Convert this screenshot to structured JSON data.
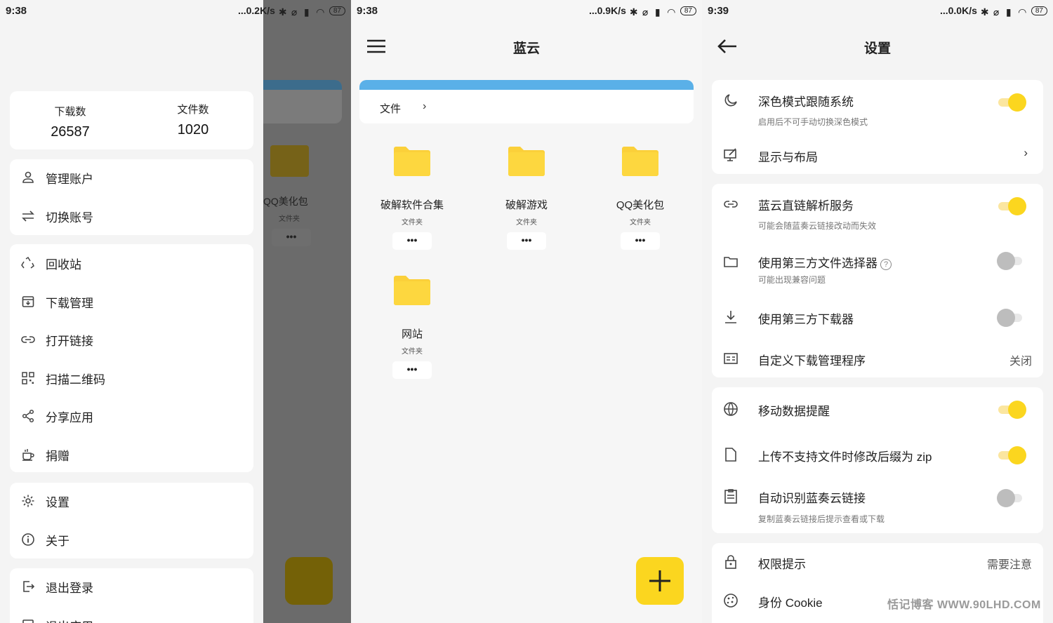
{
  "panel1": {
    "status": {
      "time": "9:38",
      "speed": "...0.2K/s",
      "battery": "87"
    },
    "stats": {
      "downloads_label": "下载数",
      "downloads_value": "26587",
      "files_label": "文件数",
      "files_value": "1020"
    },
    "group1": [
      {
        "label": "管理账户",
        "icon": "person-icon"
      },
      {
        "label": "切换账号",
        "icon": "swap-icon"
      }
    ],
    "group2": [
      {
        "label": "回收站",
        "icon": "recycle-icon"
      },
      {
        "label": "下载管理",
        "icon": "download-box-icon"
      },
      {
        "label": "打开链接",
        "icon": "link-icon"
      },
      {
        "label": "扫描二维码",
        "icon": "qrcode-icon"
      },
      {
        "label": "分享应用",
        "icon": "share-icon"
      },
      {
        "label": "捐赠",
        "icon": "coffee-icon"
      }
    ],
    "group3": [
      {
        "label": "设置",
        "icon": "gear-icon"
      },
      {
        "label": "关于",
        "icon": "info-icon"
      }
    ],
    "group4": [
      {
        "label": "退出登录",
        "icon": "logout-icon"
      },
      {
        "label": "退出应用",
        "icon": "exit-icon"
      }
    ],
    "behind": {
      "folder_name": "QQ美化包",
      "folder_sub": "文件夹",
      "more": "•••"
    }
  },
  "panel2": {
    "status": {
      "time": "9:38",
      "speed": "...0.9K/s",
      "battery": "87"
    },
    "title": "蓝云",
    "breadcrumb": "文件",
    "folders": [
      {
        "name": "破解软件合集",
        "sub": "文件夹",
        "more": "•••"
      },
      {
        "name": "破解游戏",
        "sub": "文件夹",
        "more": "•••"
      },
      {
        "name": "QQ美化包",
        "sub": "文件夹",
        "more": "•••"
      },
      {
        "name": "网站",
        "sub": "文件夹",
        "more": "•••"
      }
    ],
    "fab": "+"
  },
  "panel3": {
    "status": {
      "time": "9:39",
      "speed": "...0.0K/s",
      "battery": "87"
    },
    "title": "设置",
    "settings": {
      "dark_mode": {
        "title": "深色模式跟随系统",
        "sub": "启用后不可手动切换深色模式",
        "on": true
      },
      "display": {
        "title": "显示与布局"
      },
      "direct_link": {
        "title": "蓝云直链解析服务",
        "sub": "可能会随蓝奏云链接改动而失效",
        "on": true
      },
      "file_picker": {
        "title": "使用第三方文件选择器",
        "sub": "可能出现兼容问题",
        "on": false,
        "help": "?"
      },
      "downloader": {
        "title": "使用第三方下载器",
        "on": false
      },
      "custom_dm": {
        "title": "自定义下载管理程序",
        "value": "关闭"
      },
      "mobile_data": {
        "title": "移动数据提醒",
        "on": true
      },
      "zip_rename": {
        "title": "上传不支持文件时修改后缀为 zip",
        "on": true
      },
      "auto_detect": {
        "title": "自动识别蓝奏云链接",
        "sub": "复制蓝奏云链接后提示查看或下载",
        "on": false
      },
      "permission": {
        "title": "权限提示",
        "value": "需要注意"
      },
      "cookie": {
        "title": "身份 Cookie"
      }
    },
    "watermark": "恬记博客 WWW.90LHD.COM"
  },
  "colors": {
    "accent": "#fbd61f",
    "link_blue": "#5ab0e8",
    "folder": "#fbd03a"
  }
}
